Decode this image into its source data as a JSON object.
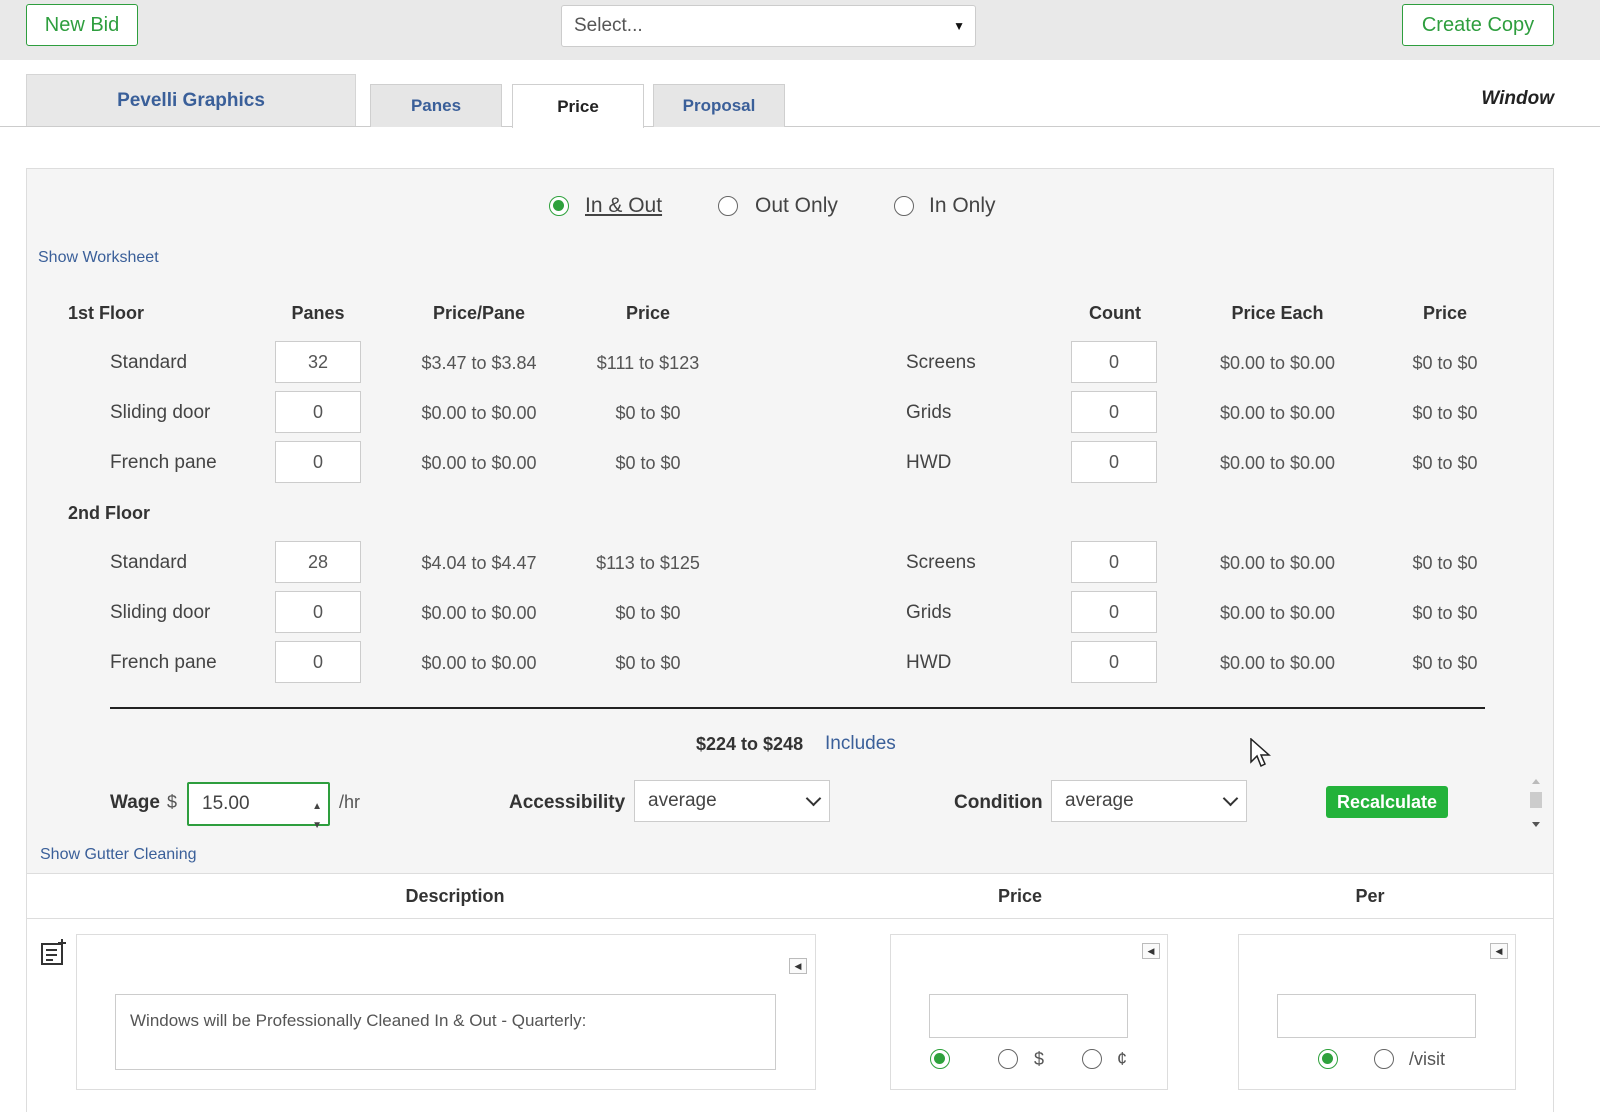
{
  "topbar": {
    "new_bid": "New Bid",
    "select_placeholder": "Select...",
    "create_copy": "Create Copy"
  },
  "tabs": {
    "company": "Pevelli Graphics",
    "items": [
      {
        "label": "Panes",
        "active": false
      },
      {
        "label": "Price",
        "active": true
      },
      {
        "label": "Proposal",
        "active": false
      }
    ],
    "right_label": "Window"
  },
  "service_mode": {
    "options": [
      "In & Out",
      "Out Only",
      "In Only"
    ],
    "selected": "In & Out"
  },
  "links": {
    "show_worksheet": "Show Worksheet",
    "show_gutter": "Show Gutter Cleaning",
    "includes": "Includes"
  },
  "headers": {
    "panes": "Panes",
    "price_pane": "Price/Pane",
    "price": "Price",
    "count": "Count",
    "price_each": "Price Each",
    "price2": "Price"
  },
  "floors": [
    {
      "name": "1st Floor",
      "rows": [
        {
          "type": "Standard",
          "panes": "32",
          "price_pane": "$3.47 to $3.84",
          "price": "$111 to $123",
          "extra": "Screens",
          "count": "0",
          "each": "$0.00 to $0.00",
          "eprice": "$0 to $0"
        },
        {
          "type": "Sliding door",
          "panes": "0",
          "price_pane": "$0.00 to $0.00",
          "price": "$0 to $0",
          "extra": "Grids",
          "count": "0",
          "each": "$0.00 to $0.00",
          "eprice": "$0 to $0"
        },
        {
          "type": "French pane",
          "panes": "0",
          "price_pane": "$0.00 to $0.00",
          "price": "$0 to $0",
          "extra": "HWD",
          "count": "0",
          "each": "$0.00 to $0.00",
          "eprice": "$0 to $0"
        }
      ]
    },
    {
      "name": "2nd Floor",
      "rows": [
        {
          "type": "Standard",
          "panes": "28",
          "price_pane": "$4.04 to $4.47",
          "price": "$113 to $125",
          "extra": "Screens",
          "count": "0",
          "each": "$0.00 to $0.00",
          "eprice": "$0 to $0"
        },
        {
          "type": "Sliding door",
          "panes": "0",
          "price_pane": "$0.00 to $0.00",
          "price": "$0 to $0",
          "extra": "Grids",
          "count": "0",
          "each": "$0.00 to $0.00",
          "eprice": "$0 to $0"
        },
        {
          "type": "French pane",
          "panes": "0",
          "price_pane": "$0.00 to $0.00",
          "price": "$0 to $0",
          "extra": "HWD",
          "count": "0",
          "each": "$0.00 to $0.00",
          "eprice": "$0 to $0"
        }
      ]
    }
  ],
  "total": "$224 to $248",
  "controls": {
    "wage_label": "Wage",
    "wage_currency": "$",
    "wage_value": "15.00",
    "wage_unit": "/hr",
    "accessibility_label": "Accessibility",
    "accessibility_value": "average",
    "condition_label": "Condition",
    "condition_value": "average",
    "recalculate": "Recalculate"
  },
  "bottom": {
    "col_description": "Description",
    "col_price": "Price",
    "col_per": "Per",
    "description_text": "Windows will be Professionally Cleaned In & Out - Quarterly:",
    "price_opt_dollar": "$",
    "price_opt_cent": "¢",
    "per_opt_visit": "/visit"
  },
  "colors": {
    "accent_green": "#2ea13c",
    "link_blue": "#3a5f99"
  }
}
